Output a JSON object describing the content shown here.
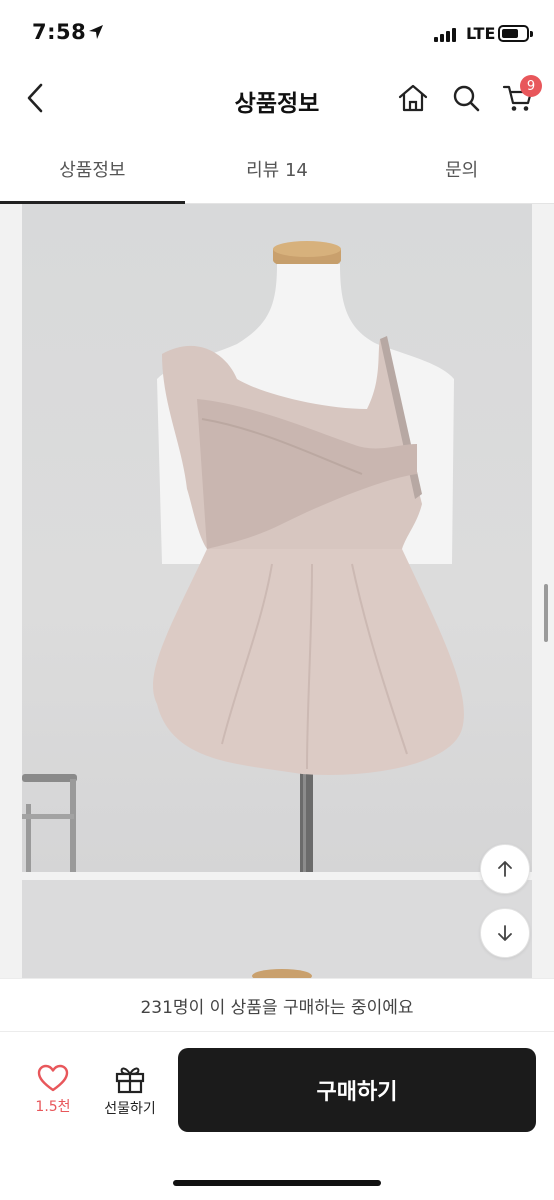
{
  "status_bar": {
    "time": "7:58",
    "network": "LTE"
  },
  "header": {
    "title": "상품정보",
    "cart_count": "9"
  },
  "tabs": [
    {
      "label": "상품정보",
      "active": true
    },
    {
      "label": "리뷰 14",
      "active": false
    },
    {
      "label": "문의",
      "active": false
    }
  ],
  "content": {
    "product_image": "pink-asymmetric-peplum-top-on-mannequin",
    "scroll_top_icon": "arrow-up-icon",
    "scroll_bottom_icon": "arrow-down-icon"
  },
  "buyers_banner": "231명이 이 상품을 구매하는 중이에요",
  "bottom_bar": {
    "like_count": "1.5천",
    "gift_label": "선물하기",
    "buy_label": "구매하기"
  },
  "colors": {
    "accent": "#e8575b",
    "buy_button": "#1b1b1b"
  }
}
